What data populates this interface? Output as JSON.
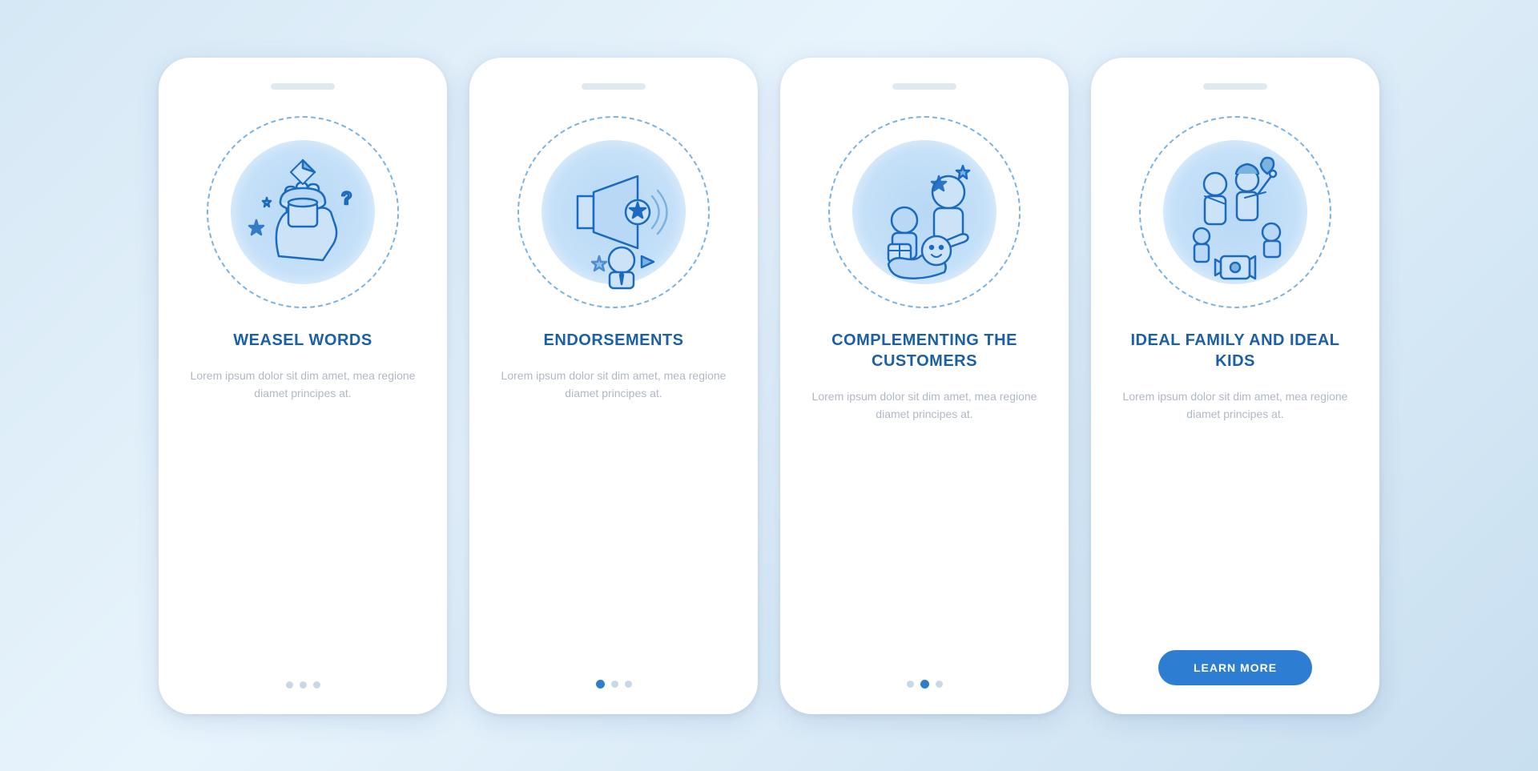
{
  "cards": [
    {
      "id": "weasel-words",
      "title": "WEASEL WORDS",
      "body": "Lorem ipsum dolor sit dim amet, mea regione diamet principes at.",
      "dots": [
        false,
        false,
        false
      ],
      "hasButton": false
    },
    {
      "id": "endorsements",
      "title": "ENDORSEMENTS",
      "body": "Lorem ipsum dolor sit dim amet, mea regione diamet principes at.",
      "dots": [
        true,
        false,
        false
      ],
      "hasButton": false
    },
    {
      "id": "complementing-customers",
      "title": "COMPLEMENTING THE CUSTOMERS",
      "body": "Lorem ipsum dolor sit dim amet, mea regione diamet principes at.",
      "dots": [
        false,
        true,
        false
      ],
      "hasButton": false
    },
    {
      "id": "ideal-family",
      "title": "IDEAL FAMILY AND IDEAL KIDS",
      "body": "Lorem ipsum dolor sit dim amet, mea regione diamet principes at.",
      "dots": [
        false,
        false,
        false
      ],
      "hasButton": true,
      "buttonLabel": "LEARN MORE"
    }
  ]
}
